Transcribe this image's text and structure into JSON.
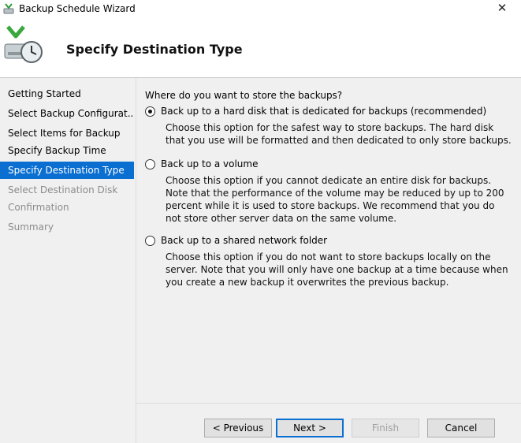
{
  "window": {
    "title": "Backup Schedule Wizard",
    "close_glyph": "✕"
  },
  "header": {
    "title": "Specify Destination Type",
    "icon": "backup-schedule-icon"
  },
  "nav": {
    "items": [
      {
        "label": "Getting Started",
        "state": "normal"
      },
      {
        "label": "Select Backup Configurat...",
        "state": "normal"
      },
      {
        "label": "Select Items for Backup",
        "state": "normal"
      },
      {
        "label": "Specify Backup Time",
        "state": "normal"
      },
      {
        "label": "Specify Destination Type",
        "state": "active"
      },
      {
        "label": "Select Destination Disk",
        "state": "disabled"
      },
      {
        "label": "Confirmation",
        "state": "disabled"
      },
      {
        "label": "Summary",
        "state": "disabled"
      }
    ]
  },
  "main": {
    "question": "Where do you want to store the backups?",
    "options": [
      {
        "label": "Back up to a hard disk that is dedicated for backups (recommended)",
        "checked": true,
        "description": "Choose this option for the safest way to store backups. The hard disk that you use will be formatted and then dedicated to only store backups."
      },
      {
        "label": "Back up to a volume",
        "checked": false,
        "description": "Choose this option if you cannot dedicate an entire disk for backups. Note that the performance of the volume may be reduced by up to 200 percent while it is used to store backups. We recommend that you do not store other server data on the same volume."
      },
      {
        "label": "Back up to a shared network folder",
        "checked": false,
        "description": "Choose this option if you do not want to store backups locally on the server. Note that you will only have one backup at a time because when you create a new backup it overwrites the previous backup."
      }
    ]
  },
  "buttons": {
    "previous": "< Previous",
    "next": "Next >",
    "finish": "Finish",
    "cancel": "Cancel"
  },
  "colors": {
    "accent": "#0a6fd1",
    "panel": "#f0f0f0"
  }
}
